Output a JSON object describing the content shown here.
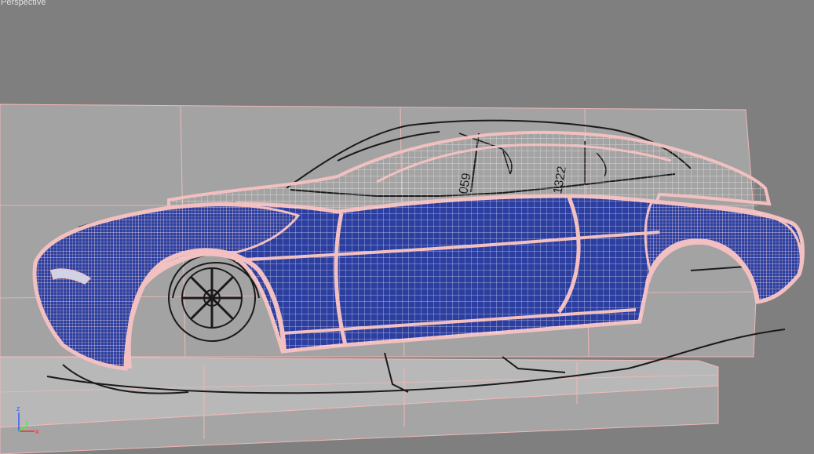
{
  "viewport": {
    "label": "Perspective",
    "background": "#7f7f7f"
  },
  "scene": {
    "mesh_fill": "#2c3fa0",
    "wire_color": "#ffffff",
    "edge_color": "#f2c0c0",
    "blueprint_plane_color": "#a4a4a4",
    "ground_plane_color": "#bdbdbd"
  },
  "gizmo": {
    "x_label": "x",
    "y_label": "y",
    "z_label": "z",
    "x_color": "#ff2a2a",
    "y_color": "#2aff2a",
    "z_color": "#3a5cff"
  }
}
